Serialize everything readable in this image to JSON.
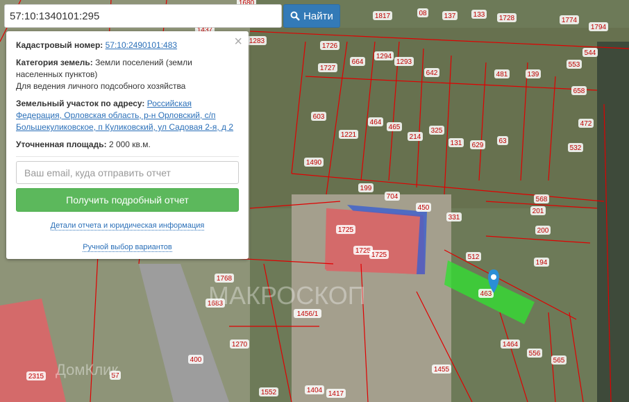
{
  "search": {
    "value": "57:10:1340101:295",
    "button_label": "Найти",
    "icon": "search-icon"
  },
  "info": {
    "cadastral_label": "Кадастровый номер:",
    "cadastral_value": "57:10:2490101:483",
    "category_label": "Категория земель:",
    "category_value": "Земли поселений (земли населенных пунктов)",
    "usage": "Для ведения личного подсобного хозяйства",
    "address_label": "Земельный участок по адресу:",
    "address_value": "Российская Федерация, Орловская область, р-н Орловский, с/п Большекуликовское, п Куликовский, ул Садовая 2-я, д 2",
    "area_label": "Уточненная площадь:",
    "area_value": "2 000 кв.м.",
    "email_placeholder": "Ваш email, куда отправить отчет",
    "report_button": "Получить подробный отчет",
    "details_link": "Детали отчета и юридическая информация",
    "manual_link": "Ручной выбор вариантов"
  },
  "map": {
    "parcel_labels": [
      "1680",
      "1437",
      "1817",
      "08",
      "137",
      "133",
      "1728",
      "1774",
      "1794",
      "1283",
      "1726",
      "664",
      "1294",
      "1293",
      "642",
      "481",
      "139",
      "544",
      "553",
      "658",
      "1727",
      "603",
      "1221",
      "464",
      "465",
      "214",
      "325",
      "131",
      "629",
      "63",
      "472",
      "532",
      "1490",
      "199",
      "704",
      "450",
      "331",
      "568",
      "201",
      "200",
      "1725",
      "1725",
      "1725",
      "512",
      "194",
      "463",
      "1768",
      "1683",
      "1456/1",
      "1270",
      "1464",
      "556",
      "565",
      "1455",
      "400",
      "2315",
      "57",
      "1404",
      "1417",
      "1552"
    ],
    "selected_parcel": "463",
    "watermarks": [
      "МАКРОСКОП",
      "ДомКлик"
    ],
    "colors": {
      "boundary": "#e00000",
      "selected": "#33dd33",
      "marker": "#2b8fd6"
    }
  }
}
